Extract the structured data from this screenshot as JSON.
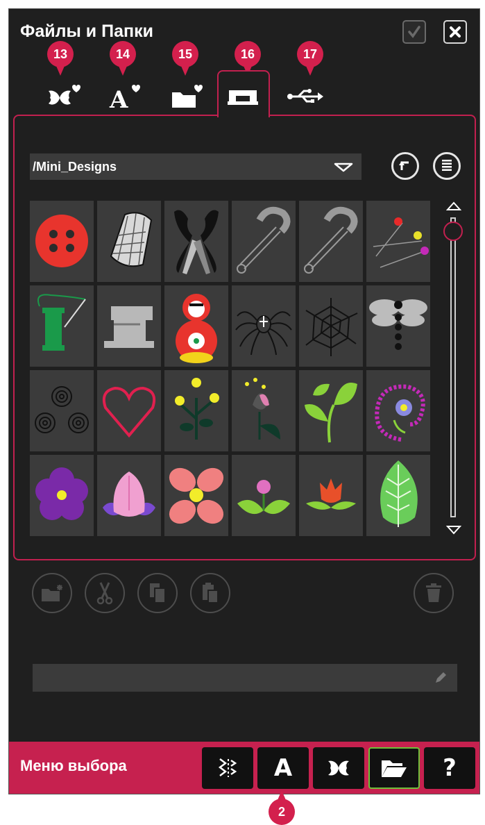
{
  "window": {
    "title": "Файлы и Папки"
  },
  "tabs": [
    {
      "number": "13",
      "icon": "butterfly-heart-icon"
    },
    {
      "number": "14",
      "icon": "letter-a-heart-icon"
    },
    {
      "number": "15",
      "icon": "folder-heart-icon"
    },
    {
      "number": "16",
      "icon": "sewing-machine-icon",
      "active": true
    },
    {
      "number": "17",
      "icon": "usb-icon"
    }
  ],
  "path": {
    "value": "/Mini_Designs"
  },
  "designs": [
    "red-button",
    "thimble",
    "scissors",
    "safety-pin",
    "safety-pin-2",
    "pins",
    "thread-spool",
    "sewing-machine",
    "matryoshka",
    "spider",
    "spider-web",
    "dragonfly",
    "spirals",
    "heart",
    "yellow-flowers",
    "tulip-bud",
    "green-leaves",
    "paisley-flower",
    "purple-flower",
    "lotus",
    "pink-flower",
    "pink-bloom",
    "red-tulip",
    "leaf"
  ],
  "bottom_bar": {
    "label": "Меню выбора",
    "buttons": [
      "stitch-icon",
      "A",
      "butterfly-icon",
      "folder-open-icon",
      "?"
    ],
    "active": "folder-open-icon"
  },
  "callout": {
    "number": "2"
  },
  "colors": {
    "accent": "#c6214f",
    "badge": "#d3204d",
    "background": "#1f1f1f",
    "cell": "#3b3b3b",
    "active_green": "#6fbf3a"
  }
}
